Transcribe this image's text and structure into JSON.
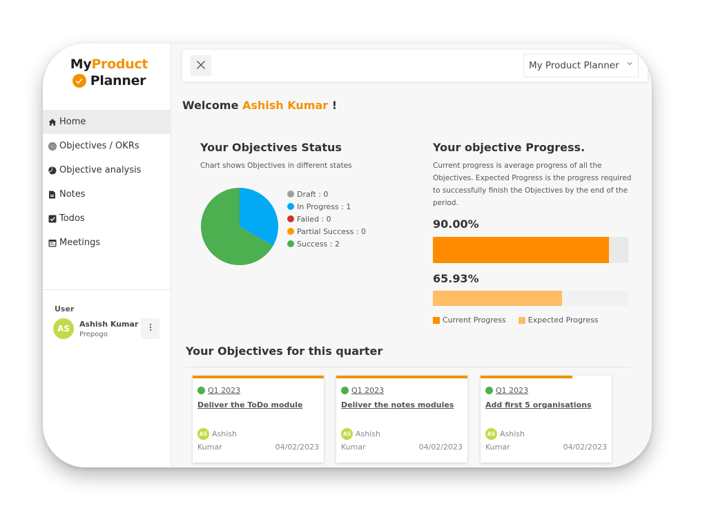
{
  "logo": {
    "part1": "My",
    "part2": "Product",
    "part3": "Planner",
    "accent_color": "#f39200"
  },
  "sidebar": {
    "items": [
      {
        "label": "Home",
        "icon": "home-icon",
        "active": true
      },
      {
        "label": "Objectives / OKRs",
        "icon": "target-icon",
        "active": false
      },
      {
        "label": "Objective analysis",
        "icon": "pie-chart-icon",
        "active": false
      },
      {
        "label": "Notes",
        "icon": "note-icon",
        "active": false
      },
      {
        "label": "Todos",
        "icon": "checkbox-icon",
        "active": false
      },
      {
        "label": "Meetings",
        "icon": "calendar-icon",
        "active": false
      }
    ],
    "user_section_label": "User",
    "user": {
      "initials": "AS",
      "name": "Ashish Kumar",
      "org": "Prepogo",
      "menu_icon": "more-vertical-icon"
    }
  },
  "topbar": {
    "close_icon": "close-icon",
    "workspace_select": "My Product Planner"
  },
  "welcome": {
    "prefix": "Welcome",
    "name": "Ashish Kumar",
    "suffix": "!"
  },
  "status_section": {
    "title": "Your Objectives Status",
    "subtitle": "Chart shows Objectives in different states"
  },
  "chart_data": {
    "type": "pie",
    "title": "Your Objectives Status",
    "legend_position": "right",
    "slices": [
      {
        "label": "Draft",
        "value": 0,
        "color": "#9e9e9e"
      },
      {
        "label": "In Progress",
        "value": 1,
        "color": "#03a9f4"
      },
      {
        "label": "Failed",
        "value": 0,
        "color": "#d32f2f"
      },
      {
        "label": "Partial Success",
        "value": 0,
        "color": "#ff9800"
      },
      {
        "label": "Success",
        "value": 2,
        "color": "#4caf50"
      }
    ],
    "legend_labels": [
      "Draft : 0",
      "In Progress : 1",
      "Failed : 0",
      "Partial Success : 0",
      "Success : 2"
    ]
  },
  "progress_section": {
    "title": "Your objective Progress.",
    "description": "Current progress is average progress of all the Objectives. Expected Progress is the progress required to successfully finish the Objectives by the end of the period.",
    "current": {
      "label": "90.00%",
      "value": 90.0,
      "color": "#ff8c00",
      "track": "#e9e9e9"
    },
    "expected": {
      "label": "65.93%",
      "value": 65.93,
      "color": "#ffbd66",
      "track": "#f1f1f1"
    },
    "legend": [
      {
        "label": "Current Progress",
        "color": "#ff8c00"
      },
      {
        "label": "Expected Progress",
        "color": "#ffbd66"
      }
    ]
  },
  "quarter_section": {
    "title": "Your Objectives for this quarter",
    "cards": [
      {
        "quarter": "Q1 2023",
        "title": "Deliver the ToDo module",
        "owner_initials": "AS",
        "owner_first": "Ashish",
        "owner_last": "Kumar",
        "date": "04/02/2023",
        "progress": 100
      },
      {
        "quarter": "Q1 2023",
        "title": "Deliver the notes modules",
        "owner_initials": "AS",
        "owner_first": "Ashish",
        "owner_last": "Kumar",
        "date": "04/02/2023",
        "progress": 100
      },
      {
        "quarter": "Q1 2023",
        "title": "Add first 5 organisations",
        "owner_initials": "AS",
        "owner_first": "Ashish",
        "owner_last": "Kumar",
        "date": "04/02/2023",
        "progress": 70
      }
    ]
  }
}
